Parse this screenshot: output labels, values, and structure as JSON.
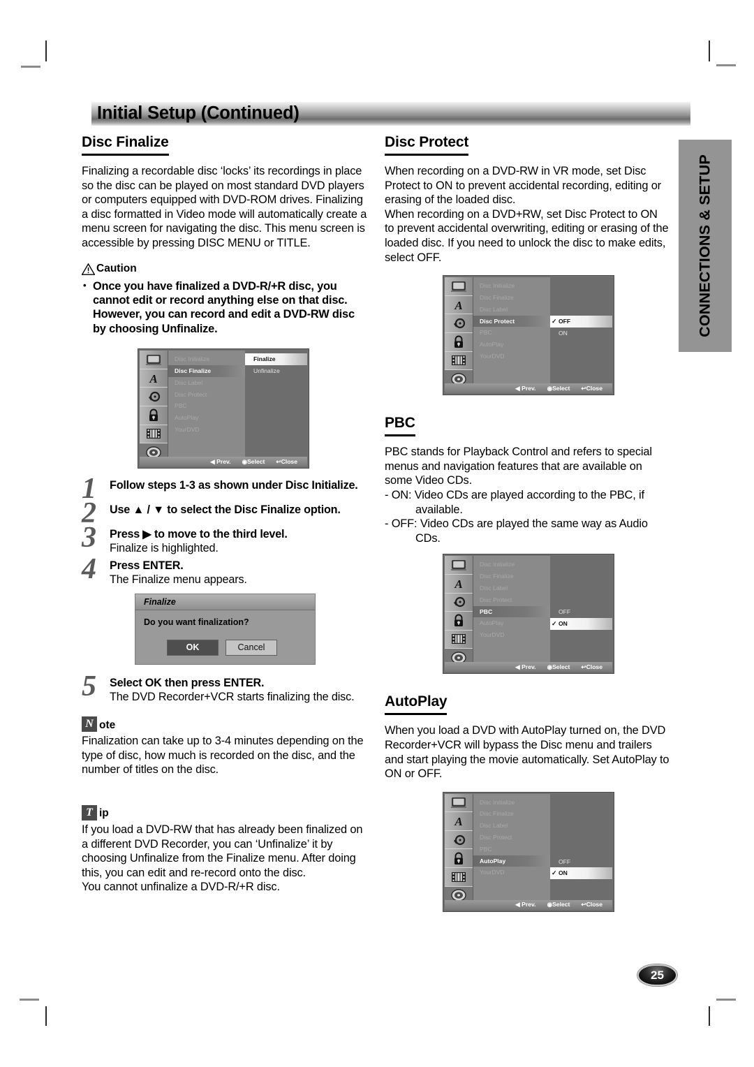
{
  "header": {
    "title": "Initial Setup (Continued)"
  },
  "side_tab": {
    "label": "CONNECTIONS & SETUP"
  },
  "page_number": "25",
  "left_column": {
    "disc_finalize": {
      "heading": "Disc Finalize",
      "paragraph": "Finalizing a recordable disc ‘locks’ its recordings in place so the disc can be played on most standard DVD players or computers equipped with DVD-ROM drives. Finalizing a disc formatted in Video mode will automatically create a menu screen for navigating the disc. This menu screen is accessible by pressing DISC MENU or TITLE.",
      "caution": {
        "label": "Caution",
        "items": [
          "Once you have finalized a DVD-R/+R disc, you cannot edit or record anything else on that disc. However, you can record and edit a DVD-RW disc by choosing Unfinalize."
        ]
      },
      "osd": {
        "menu_items": [
          "Disc Initialize",
          "Disc Finalize",
          "Disc Label",
          "Disc Protect",
          "PBC",
          "AutoPlay",
          "YourDVD"
        ],
        "selected_item": "Disc Finalize",
        "options": [
          "Finalize",
          "Unfinalize"
        ],
        "selected_option": "Finalize",
        "checked_option": "",
        "footer": {
          "prev": "Prev.",
          "select": "Select",
          "close": "Close"
        },
        "icons": [
          "tv-icon",
          "letter-a-icon",
          "audio-disc-icon",
          "padlock-icon",
          "film-strip-icon",
          "disc-icon"
        ],
        "active_icon_index": 5
      },
      "steps": [
        {
          "num": "1",
          "bold": "Follow steps 1-3 as shown under Disc Initialize.",
          "normal": ""
        },
        {
          "num": "2",
          "bold": "Use ▲ / ▼ to select the Disc Finalize option.",
          "normal": ""
        },
        {
          "num": "3",
          "bold": "Press ▶ to move to the third level.",
          "normal": "Finalize is highlighted."
        },
        {
          "num": "4",
          "bold": "Press ENTER.",
          "normal": "The Finalize menu appears."
        }
      ],
      "dialog": {
        "title": "Finalize",
        "message": "Do you want finalization?",
        "ok_label": "OK",
        "cancel_label": "Cancel"
      },
      "step5": {
        "num": "5",
        "bold": "Select OK then press ENTER.",
        "normal": "The DVD Recorder+VCR starts finalizing the disc."
      },
      "note": {
        "badge": "N",
        "label": "ote",
        "text": "Finalization can take up to 3-4 minutes depending on the type of disc, how much is recorded on the disc, and the number of titles on the disc."
      },
      "tip": {
        "badge": "T",
        "label": "ip",
        "text": "If you load a DVD-RW that has already been finalized on a different DVD Recorder, you can ‘Unfinalize’ it by choosing Unfinalize from the Finalize menu. After doing this, you can edit and re-record onto the disc.",
        "text2": "You cannot unfinalize a DVD-R/+R disc."
      }
    }
  },
  "right_column": {
    "disc_protect": {
      "heading": "Disc Protect",
      "paragraph1": "When recording on a DVD-RW in VR mode, set Disc Protect to ON to prevent accidental recording, editing or erasing of the loaded disc.",
      "paragraph2": "When recording on a DVD+RW, set Disc Protect to ON to prevent accidental overwriting, editing or erasing of the loaded disc. If you need to unlock the disc to make edits, select OFF.",
      "osd": {
        "menu_items": [
          "Disc Initialize",
          "Disc Finalize",
          "Disc Label",
          "Disc Protect",
          "PBC",
          "AutoPlay",
          "YourDVD"
        ],
        "selected_item": "Disc Protect",
        "options": [
          "OFF",
          "ON"
        ],
        "selected_option": "OFF",
        "checked_option": "OFF",
        "footer": {
          "prev": "Prev.",
          "select": "Select",
          "close": "Close"
        },
        "icons": [
          "tv-icon",
          "letter-a-icon",
          "audio-disc-icon",
          "padlock-icon",
          "film-strip-icon",
          "disc-icon"
        ],
        "active_icon_index": 5
      }
    },
    "pbc": {
      "heading": "PBC",
      "paragraph": "PBC stands for Playback Control and refers to special menus and navigation features that are available on some Video CDs.",
      "bullet_on": "- ON: Video CDs are played according to the PBC, if",
      "bullet_on_cont": "available.",
      "bullet_off": "- OFF: Video CDs are played the same way as Audio",
      "bullet_off_cont": "CDs.",
      "osd": {
        "menu_items": [
          "Disc Initialize",
          "Disc Finalize",
          "Disc Label",
          "Disc Protect",
          "PBC",
          "AutoPlay",
          "YourDVD"
        ],
        "selected_item": "PBC",
        "options": [
          "OFF",
          "ON"
        ],
        "selected_option": "ON",
        "checked_option": "ON",
        "footer": {
          "prev": "Prev.",
          "select": "Select",
          "close": "Close"
        },
        "icons": [
          "tv-icon",
          "letter-a-icon",
          "audio-disc-icon",
          "padlock-icon",
          "film-strip-icon",
          "disc-icon"
        ],
        "active_icon_index": 5
      }
    },
    "autoplay": {
      "heading": "AutoPlay",
      "paragraph": "When you load a DVD with AutoPlay turned on, the DVD Recorder+VCR will bypass the Disc menu and trailers and start playing the movie automatically. Set AutoPlay to ON or OFF.",
      "osd": {
        "menu_items": [
          "Disc Initialize",
          "Disc Finalize",
          "Disc Label",
          "Disc Protect",
          "PBC",
          "AutoPlay",
          "YourDVD"
        ],
        "selected_item": "AutoPlay",
        "options": [
          "OFF",
          "ON"
        ],
        "selected_option": "ON",
        "checked_option": "ON",
        "footer": {
          "prev": "Prev.",
          "select": "Select",
          "close": "Close"
        },
        "icons": [
          "tv-icon",
          "letter-a-icon",
          "audio-disc-icon",
          "padlock-icon",
          "film-strip-icon",
          "disc-icon"
        ],
        "active_icon_index": 5
      }
    }
  }
}
